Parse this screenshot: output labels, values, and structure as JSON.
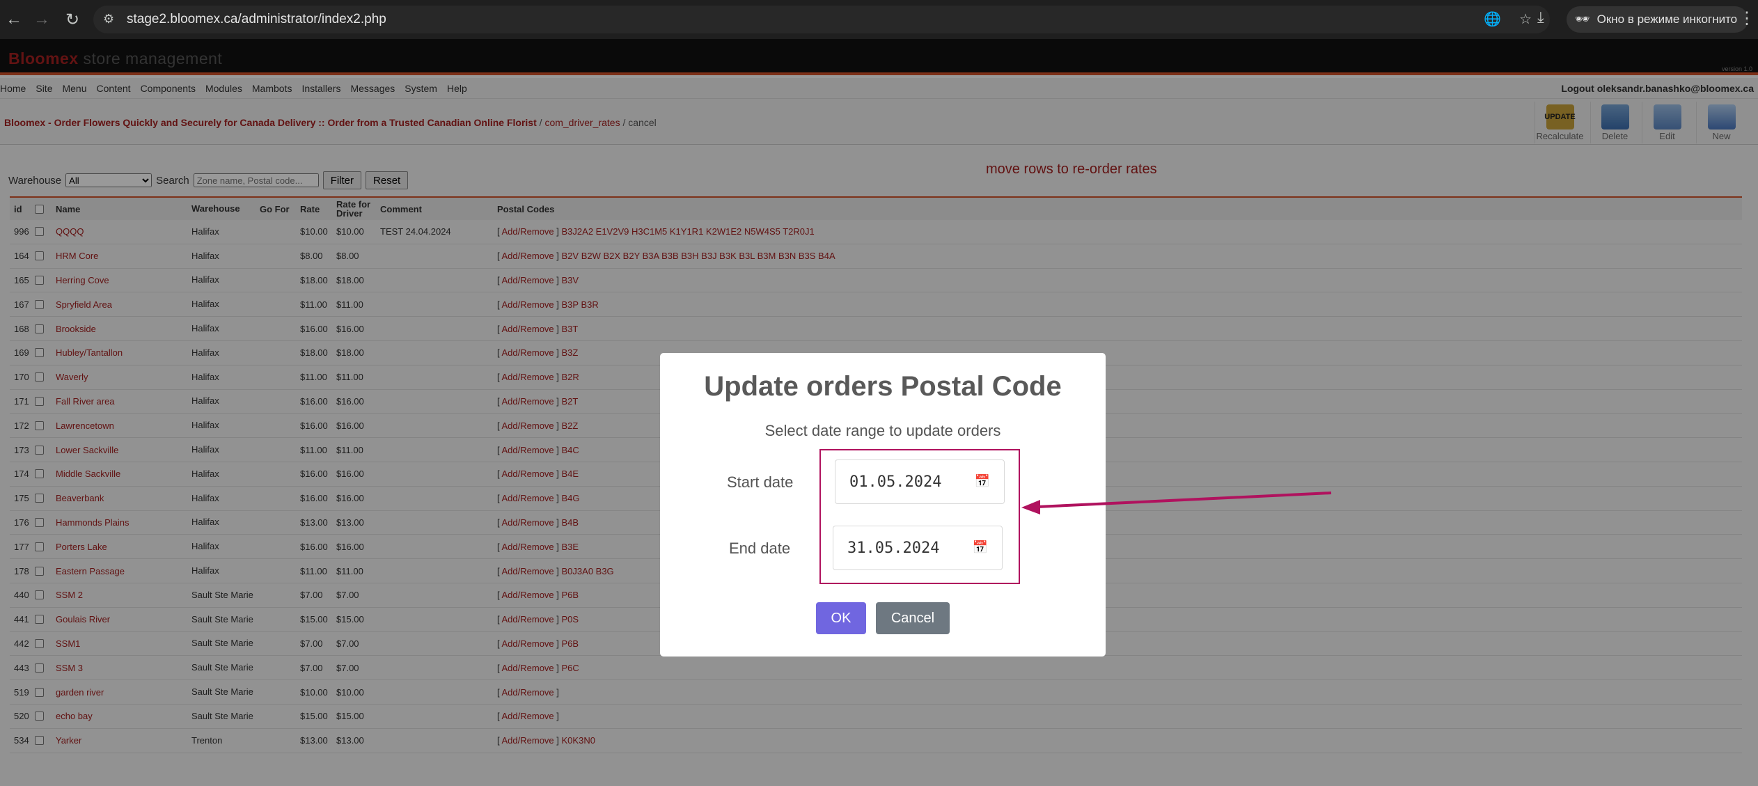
{
  "browser": {
    "url": "stage2.bloomex.ca/administrator/index2.php",
    "incognito_label": "Окно в режиме инкогнито"
  },
  "banner": {
    "brand": "Bloomex",
    "subtitle": "store management",
    "version": "version 1.0"
  },
  "menu": {
    "items": [
      "Home",
      "Site",
      "Menu",
      "Content",
      "Components",
      "Modules",
      "Mambots",
      "Installers",
      "Messages",
      "System",
      "Help"
    ],
    "logout": "Logout oleksandr.banashko@bloomex.ca"
  },
  "breadcrumb": {
    "site": "Bloomex - Order Flowers Quickly and Securely for Canada Delivery :: Order from a Trusted Canadian Online Florist",
    "sep1": " / ",
    "component": "com_driver_rates",
    "sep2": " / ",
    "action": "cancel"
  },
  "toolbar": {
    "recalculate": "Recalculate",
    "update_badge": "UPDATE",
    "delete": "Delete",
    "edit": "Edit",
    "new": "New"
  },
  "filter": {
    "warehouse_label": "Warehouse",
    "warehouse_value": "All",
    "search_label": "Search",
    "search_placeholder": "Zone name, Postal code...",
    "filter_btn": "Filter",
    "reset_btn": "Reset"
  },
  "reorder_hint": "move rows to re-order rates",
  "table": {
    "headers": {
      "id": "id",
      "name": "Name",
      "warehouse": "Warehouse",
      "go_for": "Go For",
      "rate": "Rate",
      "rate_driver": "Rate for Driver",
      "comment": "Comment",
      "postal": "Postal Codes"
    },
    "add_remove": "Add/Remove",
    "rows": [
      {
        "id": "996",
        "name": "QQQQ",
        "wh": "Halifax",
        "rate": "$10.00",
        "rd": "$10.00",
        "comment": "TEST 24.04.2024",
        "codes": "B3J2A2 E1V2V9 H3C1M5 K1Y1R1 K2W1E2 N5W4S5 T2R0J1"
      },
      {
        "id": "164",
        "name": "HRM Core",
        "wh": "Halifax",
        "rate": "$8.00",
        "rd": "$8.00",
        "comment": "",
        "codes": "B2V B2W B2X B2Y B3A B3B B3H B3J B3K B3L B3M B3N B3S B4A"
      },
      {
        "id": "165",
        "name": "Herring Cove",
        "wh": "Halifax",
        "rate": "$18.00",
        "rd": "$18.00",
        "comment": "",
        "codes": "B3V"
      },
      {
        "id": "167",
        "name": "Spryfield Area",
        "wh": "Halifax",
        "rate": "$11.00",
        "rd": "$11.00",
        "comment": "",
        "codes": "B3P B3R"
      },
      {
        "id": "168",
        "name": "Brookside",
        "wh": "Halifax",
        "rate": "$16.00",
        "rd": "$16.00",
        "comment": "",
        "codes": "B3T"
      },
      {
        "id": "169",
        "name": "Hubley/Tantallon",
        "wh": "Halifax",
        "rate": "$18.00",
        "rd": "$18.00",
        "comment": "",
        "codes": "B3Z"
      },
      {
        "id": "170",
        "name": "Waverly",
        "wh": "Halifax",
        "rate": "$11.00",
        "rd": "$11.00",
        "comment": "",
        "codes": "B2R"
      },
      {
        "id": "171",
        "name": "Fall River area",
        "wh": "Halifax",
        "rate": "$16.00",
        "rd": "$16.00",
        "comment": "",
        "codes": "B2T"
      },
      {
        "id": "172",
        "name": "Lawrencetown",
        "wh": "Halifax",
        "rate": "$16.00",
        "rd": "$16.00",
        "comment": "",
        "codes": "B2Z"
      },
      {
        "id": "173",
        "name": "Lower Sackville",
        "wh": "Halifax",
        "rate": "$11.00",
        "rd": "$11.00",
        "comment": "",
        "codes": "B4C"
      },
      {
        "id": "174",
        "name": "Middle Sackville",
        "wh": "Halifax",
        "rate": "$16.00",
        "rd": "$16.00",
        "comment": "",
        "codes": "B4E"
      },
      {
        "id": "175",
        "name": "Beaverbank",
        "wh": "Halifax",
        "rate": "$16.00",
        "rd": "$16.00",
        "comment": "",
        "codes": "B4G"
      },
      {
        "id": "176",
        "name": "Hammonds Plains",
        "wh": "Halifax",
        "rate": "$13.00",
        "rd": "$13.00",
        "comment": "",
        "codes": "B4B"
      },
      {
        "id": "177",
        "name": "Porters Lake",
        "wh": "Halifax",
        "rate": "$16.00",
        "rd": "$16.00",
        "comment": "",
        "codes": "B3E"
      },
      {
        "id": "178",
        "name": "Eastern Passage",
        "wh": "Halifax",
        "rate": "$11.00",
        "rd": "$11.00",
        "comment": "",
        "codes": "B0J3A0 B3G"
      },
      {
        "id": "440",
        "name": "SSM 2",
        "wh": "Sault Ste Marie",
        "rate": "$7.00",
        "rd": "$7.00",
        "comment": "",
        "codes": "P6B"
      },
      {
        "id": "441",
        "name": "Goulais River",
        "wh": "Sault Ste Marie",
        "rate": "$15.00",
        "rd": "$15.00",
        "comment": "",
        "codes": "P0S"
      },
      {
        "id": "442",
        "name": "SSM1",
        "wh": "Sault Ste Marie",
        "rate": "$7.00",
        "rd": "$7.00",
        "comment": "",
        "codes": "P6B"
      },
      {
        "id": "443",
        "name": "SSM 3",
        "wh": "Sault Ste Marie",
        "rate": "$7.00",
        "rd": "$7.00",
        "comment": "",
        "codes": "P6C"
      },
      {
        "id": "519",
        "name": "garden river",
        "wh": "Sault Ste Marie",
        "rate": "$10.00",
        "rd": "$10.00",
        "comment": "",
        "codes": ""
      },
      {
        "id": "520",
        "name": "echo bay",
        "wh": "Sault Ste Marie",
        "rate": "$15.00",
        "rd": "$15.00",
        "comment": "",
        "codes": ""
      },
      {
        "id": "534",
        "name": "Yarker",
        "wh": "Trenton",
        "rate": "$13.00",
        "rd": "$13.00",
        "comment": "",
        "codes": "K0K3N0"
      }
    ]
  },
  "modal": {
    "title": "Update orders Postal Code",
    "subtitle": "Select date range to update orders",
    "start_label": "Start date",
    "start_value": "01.05.2024",
    "end_label": "End date",
    "end_value": "31.05.2024",
    "ok": "OK",
    "cancel": "Cancel"
  },
  "annotation_color": "#b0125e"
}
